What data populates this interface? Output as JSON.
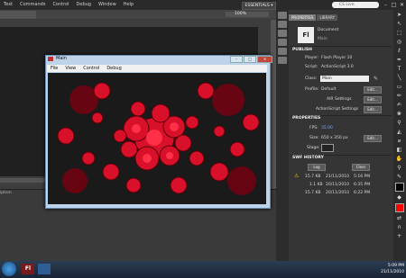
{
  "menubar": {
    "items": [
      "Text",
      "Commands",
      "Control",
      "Debug",
      "Window",
      "Help"
    ]
  },
  "workspace": {
    "label": "ESSENTIALS ▾",
    "search_placeholder": "CS Live"
  },
  "document": {
    "zoom": "100%"
  },
  "bottom_panel": {
    "tab_label": "iption"
  },
  "properties": {
    "tab_properties": "PROPERTIES",
    "tab_library": "LIBRARY",
    "doc_type": "Document",
    "doc_name": "Main",
    "publish_header": "PUBLISH",
    "player_label": "Player:",
    "player_value": "Flash Player 10",
    "script_label": "Script:",
    "script_value": "ActionScript 3.0",
    "class_label": "Class:",
    "class_value": "Main",
    "profile_label": "Profile:",
    "profile_value": "Default",
    "edit_label": "Edit...",
    "air_settings": "AIR Settings",
    "as_settings": "ActionScript Settings",
    "properties_header": "PROPERTIES",
    "fps_label": "FPS:",
    "fps_value": "35.00",
    "size_label": "Size:",
    "size_value": "650 x 350 px",
    "stage_label": "Stage:",
    "swf_header": "SWF HISTORY",
    "log_button": "Log",
    "clear_button": "Clear",
    "history": [
      {
        "size": "15.7 KB",
        "date": "21/11/2010",
        "time": "5:16 PM",
        "warn": true
      },
      {
        "size": "1.1 KB",
        "date": "20/11/2010",
        "time": "6:35 PM",
        "warn": false
      },
      {
        "size": "15.7 KB",
        "date": "20/11/2010",
        "time": "6:22 PM",
        "warn": false
      }
    ]
  },
  "player": {
    "title": "Main",
    "menu": [
      "File",
      "View",
      "Control",
      "Debug"
    ]
  },
  "taskbar": {
    "time": "5:09 PM",
    "date": "21/11/2010"
  },
  "colors": {
    "accent_red": "#e0102a",
    "stage_color": "#222222",
    "fill_swatch": "#ff0000"
  }
}
